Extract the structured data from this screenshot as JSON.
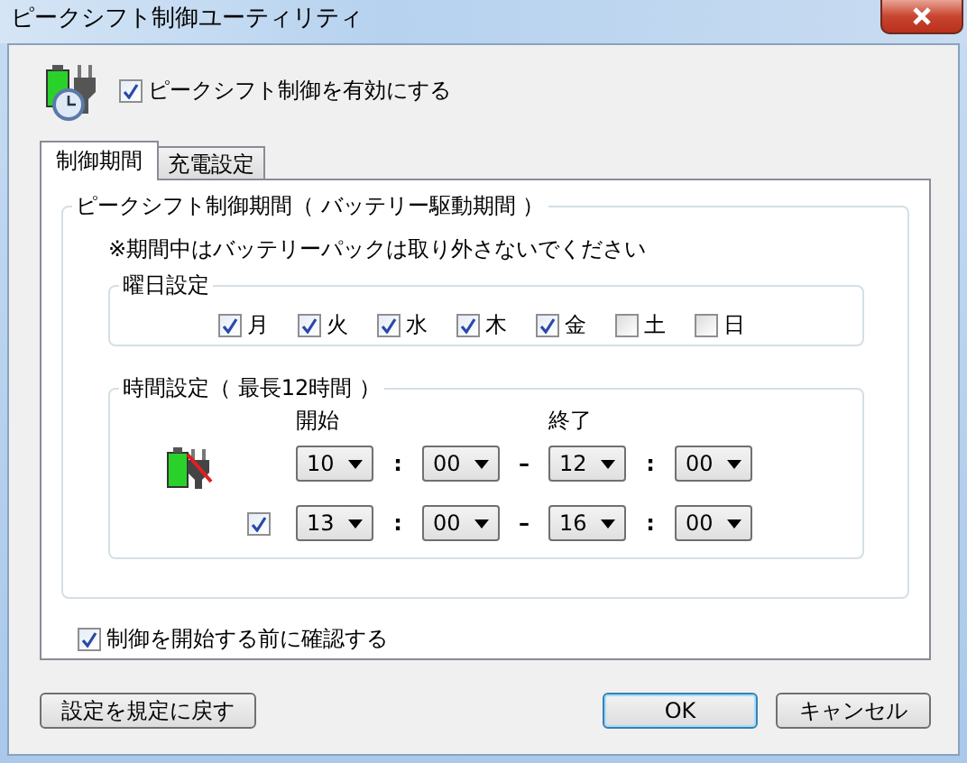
{
  "window": {
    "title": "ピークシフト制御ユーティリティ"
  },
  "enable": {
    "label": "ピークシフト制御を有効にする",
    "checked": true
  },
  "tabs": [
    {
      "label": "制御期間",
      "selected": true
    },
    {
      "label": "充電設定",
      "selected": false
    }
  ],
  "period_group": {
    "title": "ピークシフト制御期間（ バッテリー駆動期間 ）",
    "note": "※期間中はバッテリーパックは取り外さないでください",
    "days_group": {
      "title": "曜日設定",
      "days": [
        {
          "label": "月",
          "checked": true
        },
        {
          "label": "火",
          "checked": true
        },
        {
          "label": "水",
          "checked": true
        },
        {
          "label": "木",
          "checked": true
        },
        {
          "label": "金",
          "checked": true
        },
        {
          "label": "土",
          "checked": false
        },
        {
          "label": "日",
          "checked": false
        }
      ]
    },
    "time_group": {
      "title": "時間設定（ 最長12時間 ）",
      "start_label": "開始",
      "end_label": "終了",
      "separator": ":",
      "dash": "–",
      "rows": [
        {
          "kind": "fixed",
          "start_hour": "10",
          "start_min": "00",
          "end_hour": "12",
          "end_min": "00"
        },
        {
          "kind": "optional",
          "checked": true,
          "start_hour": "13",
          "start_min": "00",
          "end_hour": "16",
          "end_min": "00"
        }
      ]
    }
  },
  "confirm": {
    "label": "制御を開始する前に確認する",
    "checked": true
  },
  "buttons": [
    {
      "label": "設定を規定に戻す",
      "kind": "reset"
    },
    {
      "label": "OK",
      "kind": "default"
    },
    {
      "label": "キャンセル",
      "kind": "normal"
    }
  ]
}
